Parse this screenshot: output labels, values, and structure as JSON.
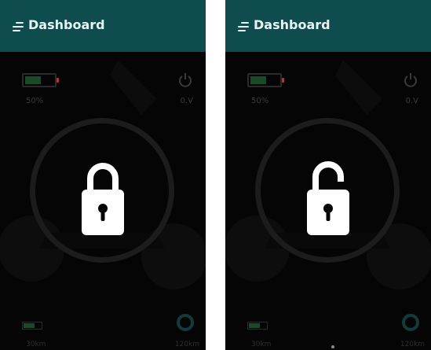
{
  "screens": [
    {
      "state": "locked",
      "appbar": {
        "title": "Dashboard",
        "menu_icon": "hamburger-icon"
      },
      "battery": {
        "percent_label": "50%",
        "level": 0.5
      },
      "power": {
        "icon": "power-icon",
        "voltage_label": "0.V"
      },
      "lock": {
        "icon": "lock-closed-icon"
      },
      "footer": {
        "speed_label": "30km",
        "distance_label": "120km"
      }
    },
    {
      "state": "unlocked",
      "appbar": {
        "title": "Dashboard",
        "menu_icon": "hamburger-icon"
      },
      "battery": {
        "percent_label": "50%",
        "level": 0.5
      },
      "power": {
        "icon": "power-icon",
        "voltage_label": "0.V"
      },
      "lock": {
        "icon": "lock-open-icon"
      },
      "footer": {
        "speed_label": "30km",
        "distance_label": "120km"
      }
    }
  ],
  "colors": {
    "appbar": "#0f4c4e",
    "title": "#e8f4f4",
    "background": "#050505",
    "lock": "#ffffff",
    "battery_fill": "#1b4a2b",
    "battery_tip": "#b33333"
  }
}
